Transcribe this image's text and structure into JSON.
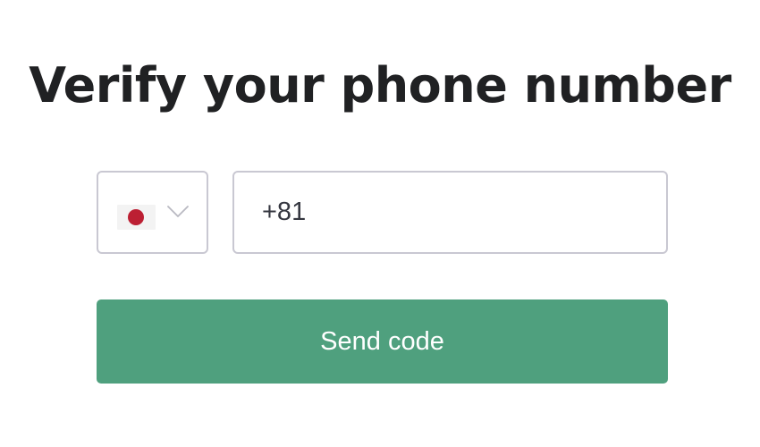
{
  "title": "Verify your phone number",
  "country_select": {
    "flag_icon": "japan-flag-icon",
    "flag_color": "#bc1f33",
    "chevron_icon": "chevron-down-icon",
    "chevron_color": "#b9b9c2"
  },
  "phone_input": {
    "value": "+81"
  },
  "send_button": {
    "label": "Send code",
    "color": "#4fa07e"
  }
}
